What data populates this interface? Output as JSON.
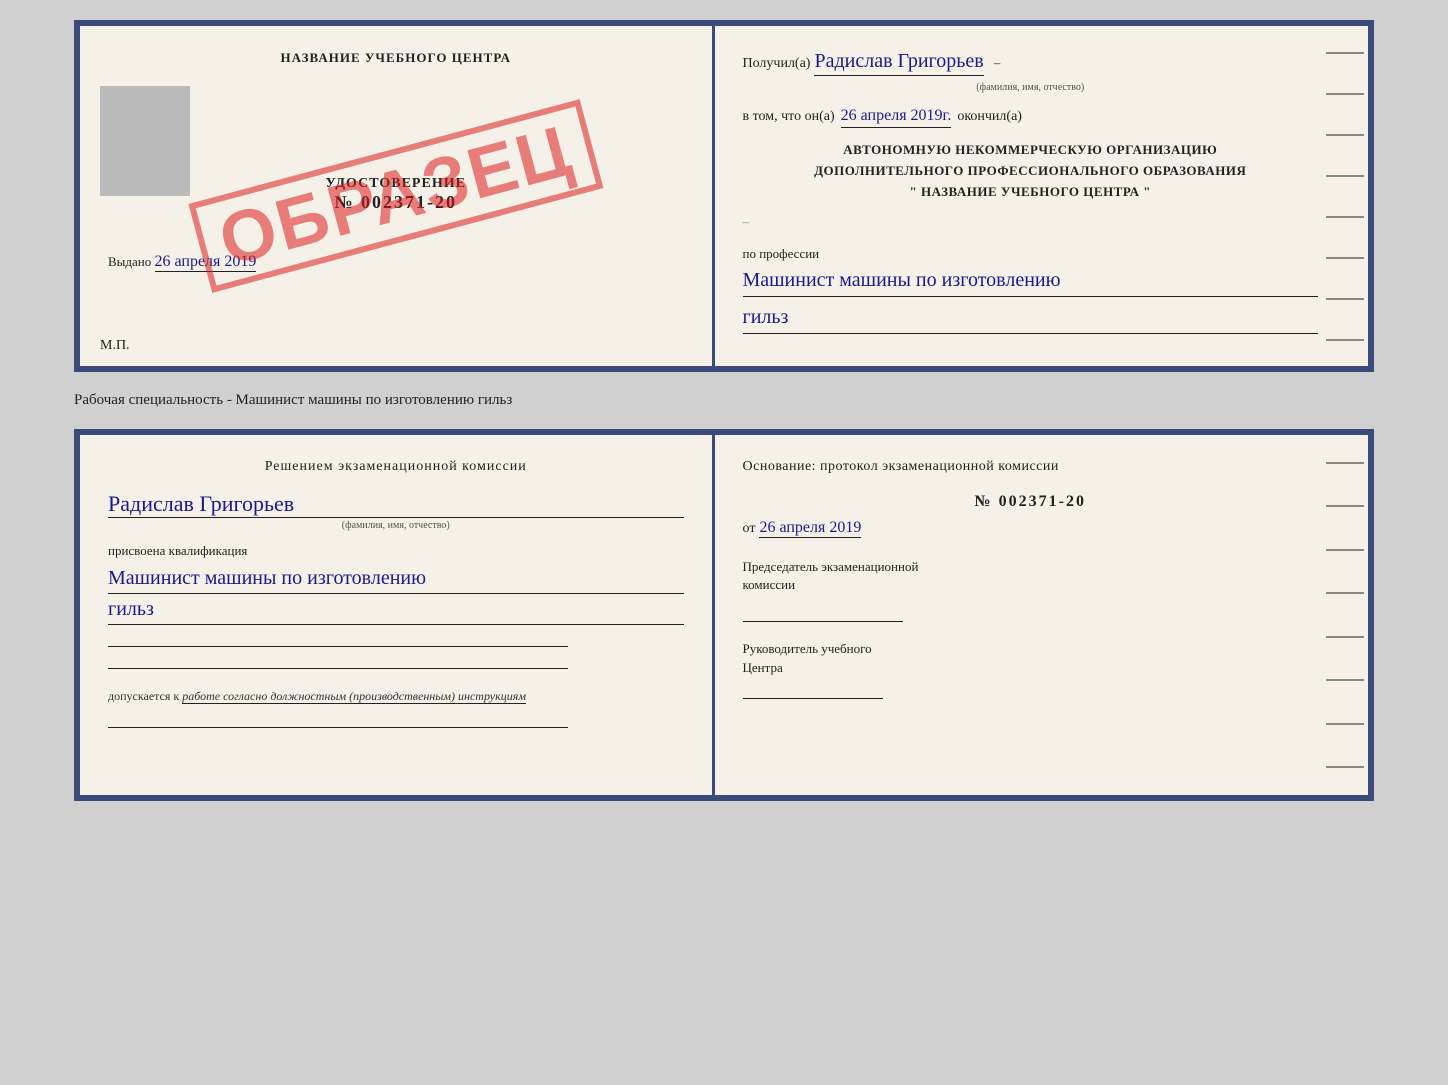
{
  "top_doc": {
    "left": {
      "school_name": "НАЗВАНИЕ УЧЕБНОГО ЦЕНТРА",
      "udostoverenie_label": "УДОСТОВЕРЕНИЕ",
      "number": "№ 002371-20",
      "vydano_text": "Выдано",
      "vydano_date": "26 апреля 2019",
      "stamp_text": "ОБРАЗЕЦ",
      "mp_label": "М.П."
    },
    "right": {
      "poluchil_prefix": "Получил(а)",
      "person_name": "Радислав Григорьев",
      "fio_subtitle": "(фамилия, имя, отчество)",
      "vtom_prefix": "в том, что он(а)",
      "date_text": "26 апреля 2019г.",
      "okonchil_text": "окончил(а)",
      "org_line1": "АВТОНОМНУЮ НЕКОММЕРЧЕСКУЮ ОРГАНИЗАЦИЮ",
      "org_line2": "ДОПОЛНИТЕЛЬНОГО ПРОФЕССИОНАЛЬНОГО ОБРАЗОВАНИЯ",
      "org_line3": "\"   НАЗВАНИЕ УЧЕБНОГО ЦЕНТРА   \"",
      "po_professii": "по профессии",
      "profession_line1": "Машинист машины по изготовлению",
      "profession_line2": "гильз"
    }
  },
  "separator": {
    "text": "Рабочая специальность - Машинист машины по изготовлению гильз"
  },
  "bottom_doc": {
    "left": {
      "resheniem_text": "Решением  экзаменационной  комиссии",
      "person_name": "Радислав Григорьев",
      "fio_subtitle": "(фамилия, имя, отчество)",
      "prisvoena_text": "присвоена квалификация",
      "kvalif_line1": "Машинист машины по изготовлению",
      "kvalif_line2": "гильз",
      "dopusk_prefix": "допускается к",
      "dopusk_text": "работе согласно должностным (производственным) инструкциям"
    },
    "right": {
      "osnovanie_text": "Основание: протокол экзаменационной  комиссии",
      "protocol_number": "№  002371-20",
      "ot_prefix": "от",
      "ot_date": "26 апреля 2019",
      "predsedatel_line1": "Председатель экзаменационной",
      "predsedatel_line2": "комиссии",
      "rukovoditel_line1": "Руководитель учебного",
      "rukovoditel_line2": "Центра"
    }
  }
}
